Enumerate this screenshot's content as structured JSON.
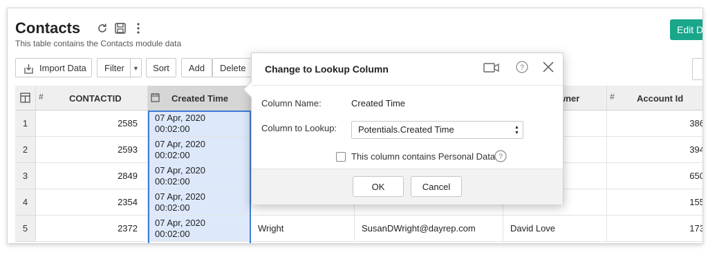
{
  "page": {
    "title": "Contacts",
    "subtitle": "This table contains the Contacts module data",
    "edit_label": "Edit D"
  },
  "toolbar": {
    "import_label": "Import Data",
    "filter_label": "Filter",
    "sort_label": "Sort",
    "add_label": "Add",
    "delete_label": "Delete"
  },
  "table": {
    "columns": [
      {
        "name": "row-index",
        "label": ""
      },
      {
        "name": "contactid",
        "label": "CONTACTID",
        "type_icon": "#"
      },
      {
        "name": "created-time",
        "label": "Created Time",
        "type_icon": "calendar-icon"
      },
      {
        "name": "last-name",
        "label": ""
      },
      {
        "name": "email",
        "label": ""
      },
      {
        "name": "owner",
        "label": "wner"
      },
      {
        "name": "account-id",
        "label": "Account Id",
        "type_icon": "#"
      }
    ],
    "rows": [
      {
        "n": "1",
        "contactid": "2585",
        "created_date": "07 Apr, 2020",
        "created_time": "00:02:00",
        "last_name": "",
        "email": "",
        "owner": "",
        "account_id": "386"
      },
      {
        "n": "2",
        "contactid": "2593",
        "created_date": "07 Apr, 2020",
        "created_time": "00:02:00",
        "last_name": "",
        "email": "",
        "owner": "",
        "account_id": "394"
      },
      {
        "n": "3",
        "contactid": "2849",
        "created_date": "07 Apr, 2020",
        "created_time": "00:02:00",
        "last_name": "",
        "email": "",
        "owner": "",
        "account_id": "650"
      },
      {
        "n": "4",
        "contactid": "2354",
        "created_date": "07 Apr, 2020",
        "created_time": "00:02:00",
        "last_name": "",
        "email": "",
        "owner": "",
        "account_id": "155"
      },
      {
        "n": "5",
        "contactid": "2372",
        "created_date": "07 Apr, 2020",
        "created_time": "00:02:00",
        "last_name": "Wright",
        "email": "SusanDWright@dayrep.com",
        "owner": "David Love",
        "account_id": "173"
      }
    ]
  },
  "dialog": {
    "title": "Change to Lookup Column",
    "column_name_label": "Column Name:",
    "column_name_value": "Created Time",
    "lookup_label": "Column to Lookup:",
    "lookup_value": "Potentials.Created Time",
    "personal_data_label": "This column contains Personal Data",
    "personal_data_checked": false,
    "ok_label": "OK",
    "cancel_label": "Cancel"
  },
  "colors": {
    "accent_green": "#19a68b",
    "selection_fill": "#dde9fb",
    "selection_border": "#3e7bd8"
  },
  "icons": [
    "reload-icon",
    "save-icon",
    "more-vertical-icon",
    "import-icon",
    "caret-down-icon",
    "column-menu-icon",
    "calendar-icon",
    "video-icon",
    "help-icon",
    "close-icon"
  ]
}
